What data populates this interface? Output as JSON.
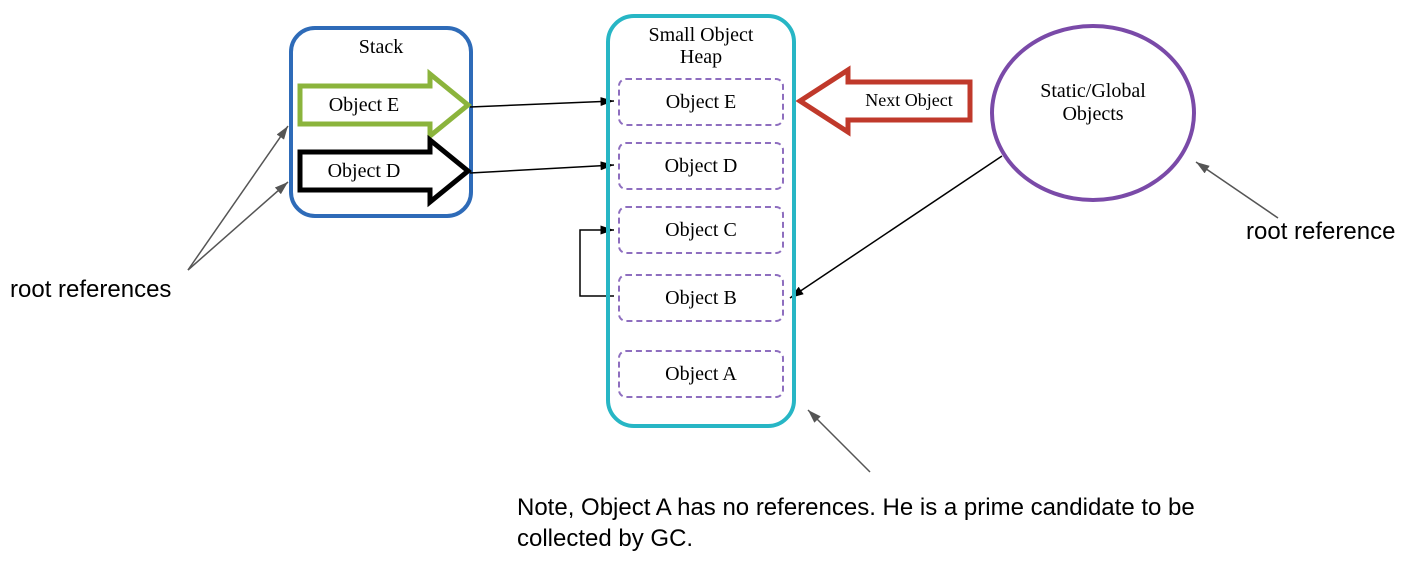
{
  "stack": {
    "title": "Stack",
    "item_e": "Object E",
    "item_d": "Object D"
  },
  "heap": {
    "title": "Small Object\nHeap",
    "items": [
      "Object E",
      "Object D",
      "Object C",
      "Object B",
      "Object A"
    ]
  },
  "globals": {
    "label": "Static/Global\nObjects"
  },
  "nextObject": "Next Object",
  "annotations": {
    "rootReferencesLeft": "root references",
    "rootReferenceRight": "root reference",
    "note": "Note, Object A has no references. He is a prime candidate to be collected by GC."
  }
}
